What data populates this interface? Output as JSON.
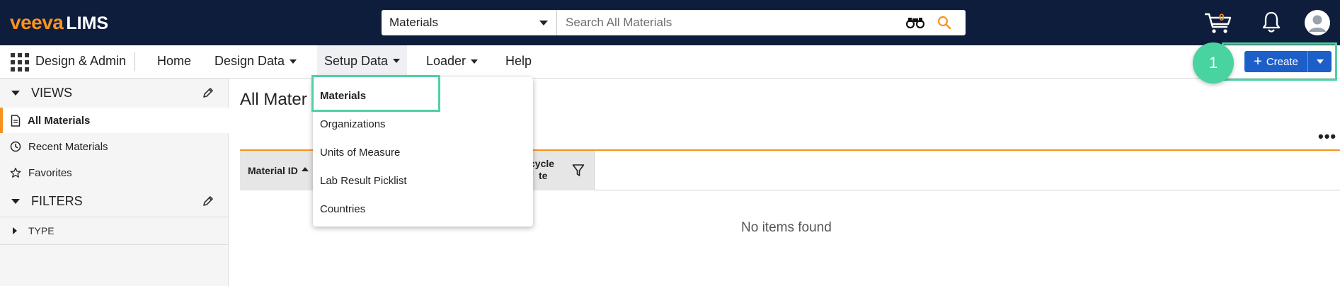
{
  "app": {
    "logo_brand": "veeva",
    "logo_product": "LIMS"
  },
  "search": {
    "scope": "Materials",
    "placeholder": "Search All Materials"
  },
  "top_icons": {
    "cart_count": "0"
  },
  "nav": {
    "app_name": "Design & Admin",
    "items": [
      "Home",
      "Design Data",
      "Setup Data",
      "Loader",
      "Help"
    ],
    "active": "Setup Data"
  },
  "create": {
    "label": "Create",
    "step_number": "1"
  },
  "sidebar": {
    "views_label": "VIEWS",
    "views": [
      "All Materials",
      "Recent Materials",
      "Favorites"
    ],
    "selected_view": "All Materials",
    "filters_label": "FILTERS",
    "filter_groups": [
      "TYPE"
    ]
  },
  "main": {
    "title": "All Materials",
    "title_visible": "All Mater",
    "columns": [
      "Material ID",
      "cycle",
      "te"
    ],
    "empty_text": "No items found"
  },
  "setup_menu": {
    "items": [
      "Materials",
      "Organizations",
      "Units of Measure",
      "Lab Result Picklist",
      "Countries"
    ],
    "highlighted": "Materials"
  },
  "colors": {
    "topbar": "#0f1d3c",
    "brand_orange": "#f7931e",
    "create_blue": "#1d5fc9",
    "highlight_green": "#4fd1a0"
  }
}
